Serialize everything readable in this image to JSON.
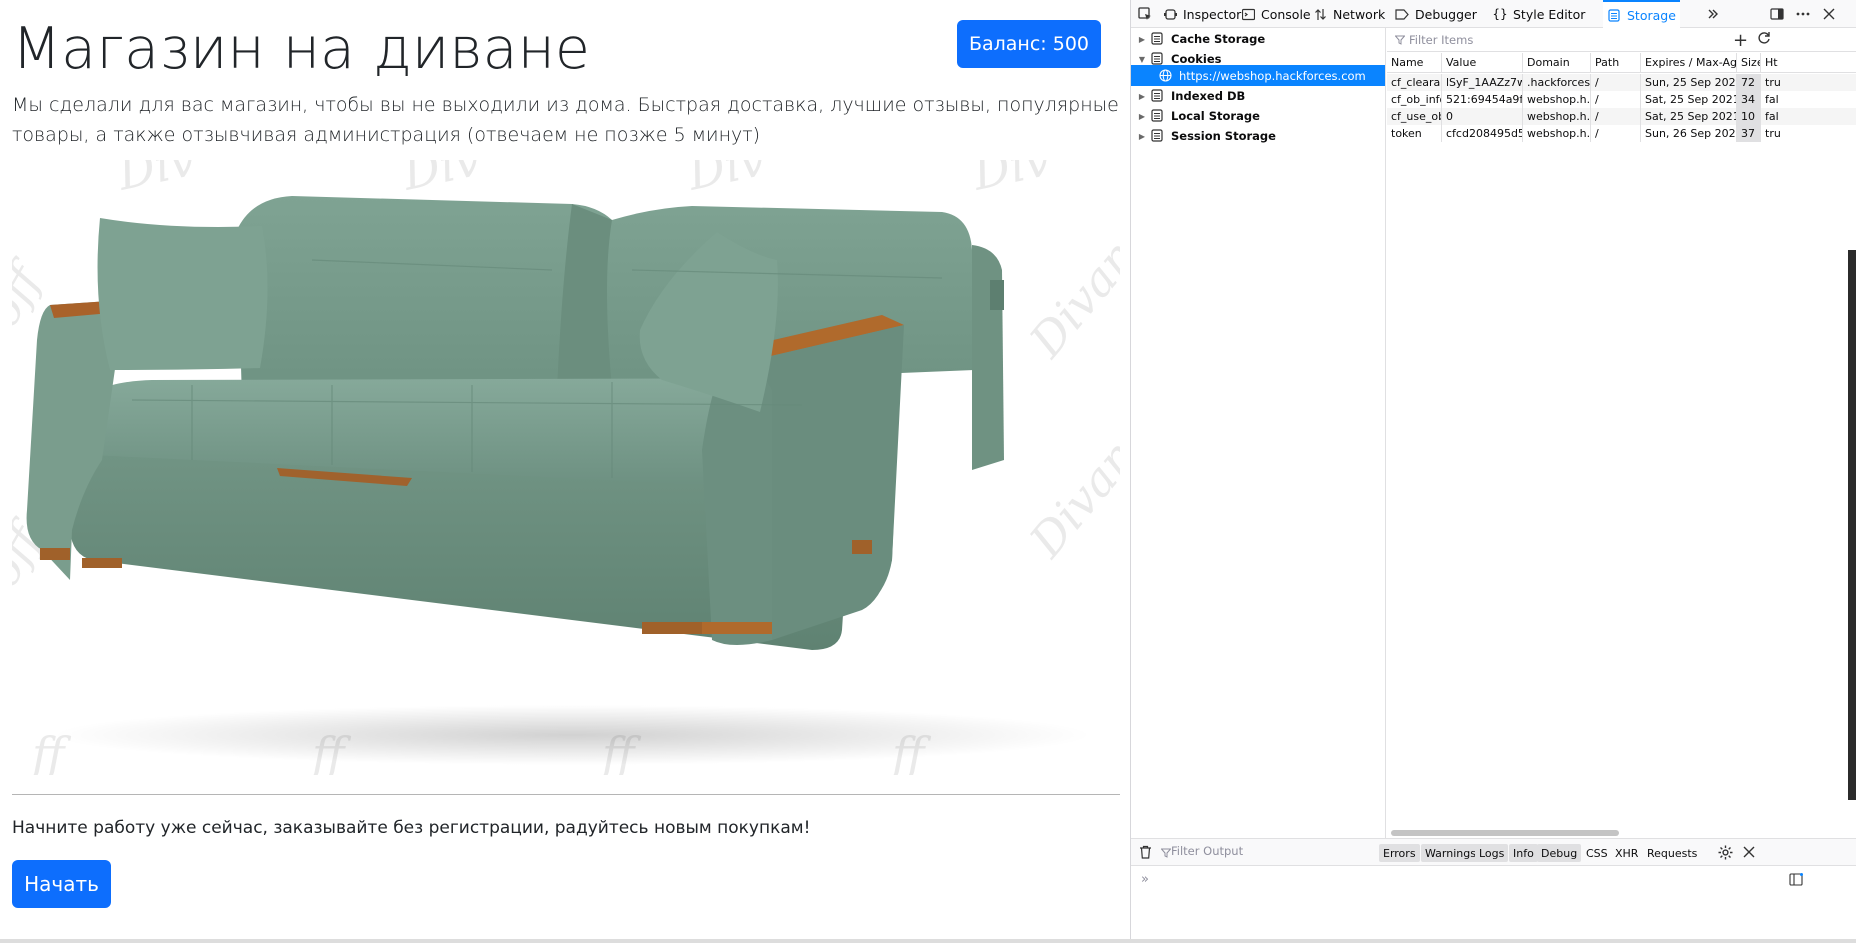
{
  "page": {
    "title": "Магазин на диване",
    "balance_label": "Баланс: 500",
    "lead": "Мы сделали для вас магазин, чтобы вы не выходили из дома. Быстрая доставка, лучшие отзывы, популярные товары, а также отзывчивая администрация (отвечаем не позже 5 минут)",
    "cta_text": "Начните работу уже сейчас, заказывайте без регистрации, радуйтесь новым покупкам!",
    "start_label": "Начать",
    "accent": "#0d6efd",
    "watermark": "Divanoff"
  },
  "devtools": {
    "tabs": [
      {
        "label": "Inspector"
      },
      {
        "label": "Console"
      },
      {
        "label": "Network"
      },
      {
        "label": "Debugger"
      },
      {
        "label": "Style Editor"
      },
      {
        "label": "Storage"
      }
    ],
    "active_tab": "Storage",
    "sidebar": {
      "items": [
        {
          "label": "Cache Storage"
        },
        {
          "label": "Cookies"
        },
        {
          "label": "https://webshop.hackforces.com"
        },
        {
          "label": "Indexed DB"
        },
        {
          "label": "Local Storage"
        },
        {
          "label": "Session Storage"
        }
      ]
    },
    "storage": {
      "filter_placeholder": "Filter Items",
      "columns": [
        "Name",
        "Value",
        "Domain",
        "Path",
        "Expires / Max-Age",
        "Size",
        "Ht"
      ],
      "rows": [
        {
          "name": "cf_cleara...",
          "value": "lSyF_1AAZz7w...",
          "domain": ".hackforces....",
          "path": "/",
          "expires": "Sun, 25 Sep 2022 1...",
          "size": "72",
          "http": "tru"
        },
        {
          "name": "cf_ob_info",
          "value": "521:69454a9f7...",
          "domain": "webshop.h...",
          "path": "/",
          "expires": "Sat, 25 Sep 2021 1...",
          "size": "34",
          "http": "fal"
        },
        {
          "name": "cf_use_ob",
          "value": "0",
          "domain": "webshop.h...",
          "path": "/",
          "expires": "Sat, 25 Sep 2021 1...",
          "size": "10",
          "http": "fal"
        },
        {
          "name": "token",
          "value": "cfcd208495d5...",
          "domain": "webshop.h...",
          "path": "/",
          "expires": "Sun, 26 Sep 2021 0...",
          "size": "37",
          "http": "tru"
        }
      ]
    },
    "console": {
      "filter_placeholder": "Filter Output",
      "levels": [
        "Errors",
        "Warnings",
        "Logs",
        "Info",
        "Debug"
      ],
      "types": [
        "CSS",
        "XHR",
        "Requests"
      ],
      "prompt": "»"
    }
  }
}
